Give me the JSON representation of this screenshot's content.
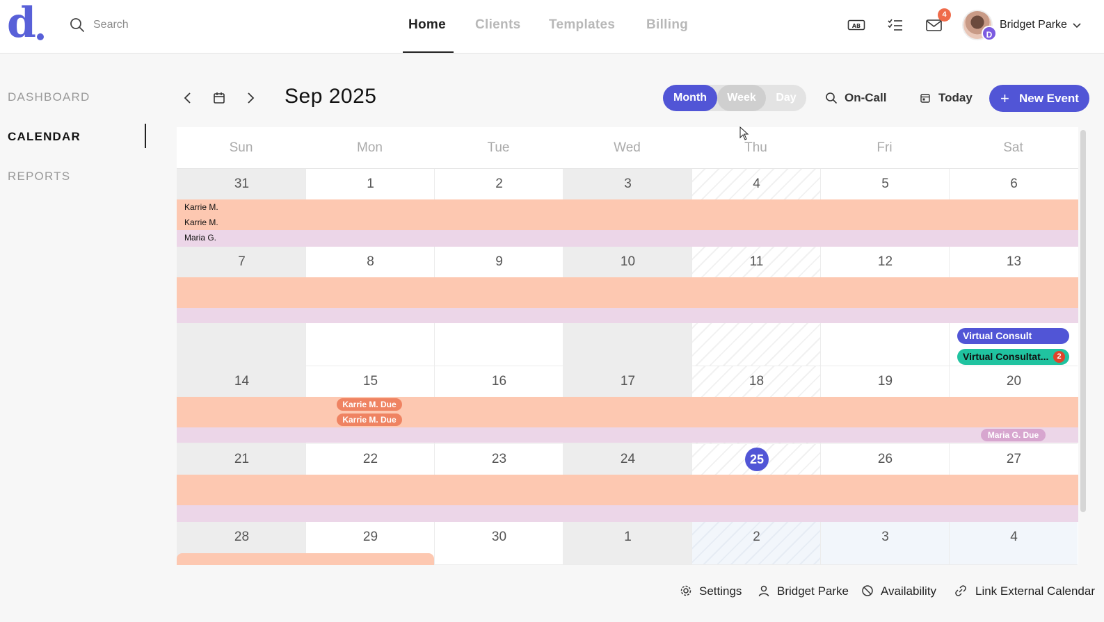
{
  "app": {
    "logo": "d"
  },
  "search": {
    "placeholder": "Search"
  },
  "nav": {
    "tabs": [
      "Home",
      "Clients",
      "Templates",
      "Billing"
    ]
  },
  "header": {
    "mail_badge": "4",
    "user_name": "Bridget Parke",
    "avatar_badge": "D"
  },
  "sidebar": {
    "items": [
      "DASHBOARD",
      "CALENDAR",
      "REPORTS"
    ]
  },
  "toolbar": {
    "month_title": "Sep 2025",
    "views": [
      "Month",
      "Week",
      "Day"
    ],
    "oncall": "On-Call",
    "today": "Today",
    "new_event": "New Event"
  },
  "calendar": {
    "weekdays": [
      "Sun",
      "Mon",
      "Tue",
      "Wed",
      "Thu",
      "Fri",
      "Sat"
    ],
    "weeks": [
      [
        "31",
        "1",
        "2",
        "3",
        "4",
        "5",
        "6"
      ],
      [
        "7",
        "8",
        "9",
        "10",
        "11",
        "12",
        "13"
      ],
      [
        "14",
        "15",
        "16",
        "17",
        "18",
        "19",
        "20"
      ],
      [
        "21",
        "22",
        "23",
        "24",
        "25",
        "26",
        "27"
      ],
      [
        "28",
        "29",
        "30",
        "1",
        "2",
        "3",
        "4"
      ]
    ],
    "today_day": "25",
    "band_labels": [
      "Karrie M.",
      "Karrie M.",
      "Maria G."
    ],
    "due_pills": [
      "Karrie M. Due",
      "Karrie M. Due",
      "Maria G. Due"
    ],
    "events": [
      "Virtual Consult",
      "Virtual Consultat..."
    ],
    "event_badge": "2"
  },
  "footer": {
    "settings": "Settings",
    "user": "Bridget Parke",
    "availability": "Availability",
    "link_calendar": "Link External Calendar"
  },
  "colors": {
    "accent": "#5155d6",
    "salmon_band": "#fdc8b1",
    "lilac_band": "#ecd6e8",
    "teal_event": "#20c3a0",
    "due_pill": "#ef8362"
  }
}
